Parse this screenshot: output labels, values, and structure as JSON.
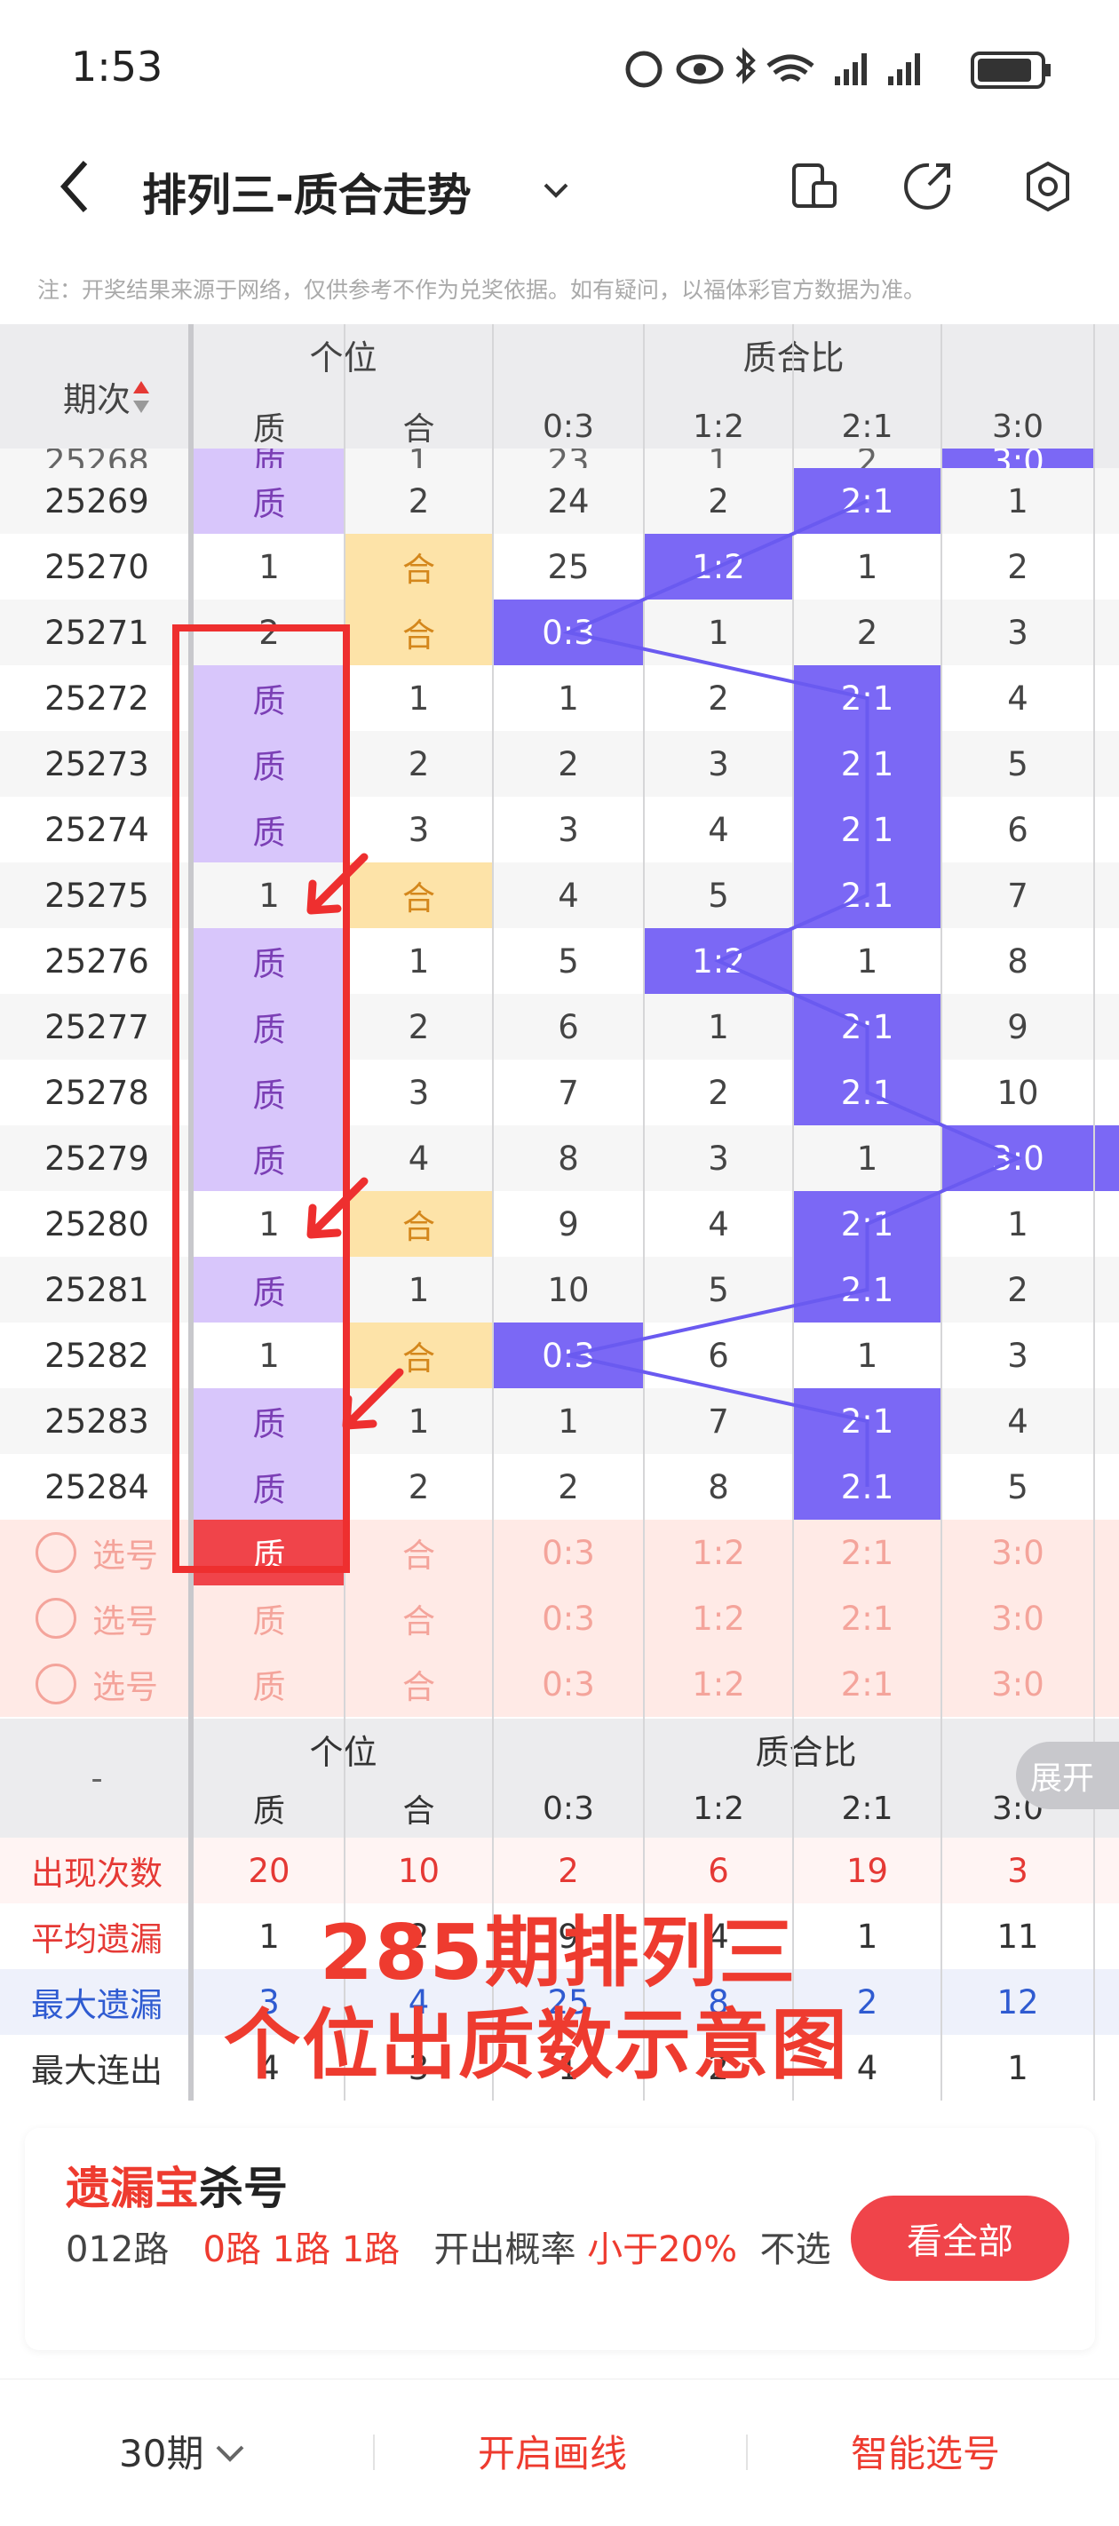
{
  "status_bar": {
    "time": "1:53"
  },
  "header": {
    "title": "排列三-质合走势"
  },
  "notice": "注：开奖结果来源于网络，仅供参考不作为兑奖依据。如有疑问，以福体彩官方数据为准。",
  "table": {
    "period_header": "期次",
    "group_ge": "个位",
    "group_ratio": "质合比",
    "cols": [
      "质",
      "合",
      "0:3",
      "1:2",
      "2:1",
      "3:0"
    ],
    "partial_row": {
      "values": [
        "25268",
        "质",
        "1",
        "23",
        "1",
        "2",
        "3:0"
      ]
    },
    "rows": [
      {
        "period": "25269",
        "zhi": "质",
        "he": "2",
        "r03": "24",
        "r12": "2",
        "r21": "2:1",
        "r30": "1"
      },
      {
        "period": "25270",
        "zhi": "1",
        "he": "合",
        "r03": "25",
        "r12": "1:2",
        "r21": "1",
        "r30": "2"
      },
      {
        "period": "25271",
        "zhi": "2",
        "he": "合",
        "r03": "0:3",
        "r12": "1",
        "r21": "2",
        "r30": "3"
      },
      {
        "period": "25272",
        "zhi": "质",
        "he": "1",
        "r03": "1",
        "r12": "2",
        "r21": "2:1",
        "r30": "4"
      },
      {
        "period": "25273",
        "zhi": "质",
        "he": "2",
        "r03": "2",
        "r12": "3",
        "r21": "2:1",
        "r30": "5"
      },
      {
        "period": "25274",
        "zhi": "质",
        "he": "3",
        "r03": "3",
        "r12": "4",
        "r21": "2:1",
        "r30": "6"
      },
      {
        "period": "25275",
        "zhi": "1",
        "he": "合",
        "r03": "4",
        "r12": "5",
        "r21": "2:1",
        "r30": "7"
      },
      {
        "period": "25276",
        "zhi": "质",
        "he": "1",
        "r03": "5",
        "r12": "1:2",
        "r21": "1",
        "r30": "8"
      },
      {
        "period": "25277",
        "zhi": "质",
        "he": "2",
        "r03": "6",
        "r12": "1",
        "r21": "2:1",
        "r30": "9"
      },
      {
        "period": "25278",
        "zhi": "质",
        "he": "3",
        "r03": "7",
        "r12": "2",
        "r21": "2:1",
        "r30": "10"
      },
      {
        "period": "25279",
        "zhi": "质",
        "he": "4",
        "r03": "8",
        "r12": "3",
        "r21": "1",
        "r30": "3:0"
      },
      {
        "period": "25280",
        "zhi": "1",
        "he": "合",
        "r03": "9",
        "r12": "4",
        "r21": "2:1",
        "r30": "1"
      },
      {
        "period": "25281",
        "zhi": "质",
        "he": "1",
        "r03": "10",
        "r12": "5",
        "r21": "2:1",
        "r30": "2"
      },
      {
        "period": "25282",
        "zhi": "1",
        "he": "合",
        "r03": "0:3",
        "r12": "6",
        "r21": "1",
        "r30": "3"
      },
      {
        "period": "25283",
        "zhi": "质",
        "he": "1",
        "r03": "1",
        "r12": "7",
        "r21": "2:1",
        "r30": "4"
      },
      {
        "period": "25284",
        "zhi": "质",
        "he": "2",
        "r03": "2",
        "r12": "8",
        "r21": "2:1",
        "r30": "5"
      }
    ],
    "select_label": "选号",
    "select_rows": [
      [
        "质",
        "合",
        "0:3",
        "1:2",
        "2:1",
        "3:0"
      ],
      [
        "质",
        "合",
        "0:3",
        "1:2",
        "2:1",
        "3:0"
      ],
      [
        "质",
        "合",
        "0:3",
        "1:2",
        "2:1",
        "3:0"
      ]
    ]
  },
  "stats": {
    "dash": "-",
    "group_ge": "个位",
    "group_ratio": "质合比",
    "cols": [
      "质",
      "合",
      "0:3",
      "1:2",
      "2:1",
      "3:0"
    ],
    "rows": [
      {
        "label": "出现次数",
        "values": [
          "20",
          "10",
          "2",
          "6",
          "19",
          "3"
        ]
      },
      {
        "label": "平均遗漏",
        "values": [
          "1",
          "2",
          "9",
          "4",
          "1",
          "11"
        ]
      },
      {
        "label": "最大遗漏",
        "values": [
          "3",
          "4",
          "25",
          "8",
          "2",
          "12"
        ]
      },
      {
        "label": "最大连出",
        "values": [
          "4",
          "3",
          "1",
          "2",
          "4",
          "1"
        ]
      }
    ],
    "expand": "展开"
  },
  "overlay": {
    "line1": "285期排列三",
    "line2": "个位出质数示意图"
  },
  "card": {
    "title_a": "遗漏宝",
    "title_b": "杀号",
    "route_label": "012路",
    "routes": "0路 1路 1路",
    "prob_label": "开出概率",
    "prob_value": "小于20%",
    "tail": "不选",
    "button": "看全部"
  },
  "footer": {
    "period": "30期",
    "draw": "开启画线",
    "smart": "智能选号"
  },
  "colors": {
    "purple": "#7b68f5",
    "light_purple": "#d8c6fb",
    "orange": "#fde3a8",
    "red": "#ee3b2f",
    "selection": "#ffeae6"
  }
}
